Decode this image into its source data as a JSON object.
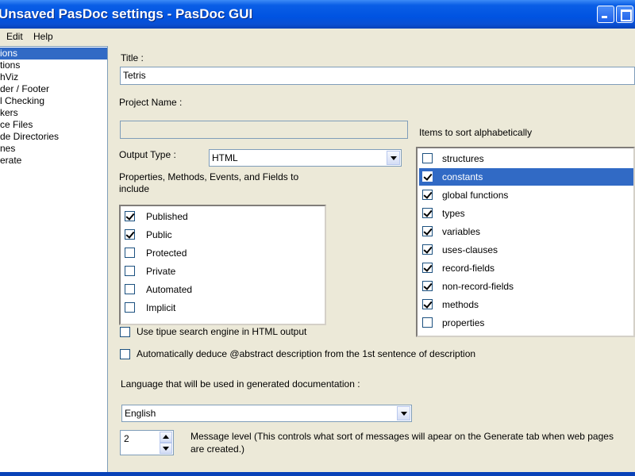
{
  "window": {
    "title": "Unsaved PasDoc settings - PasDoc GUI"
  },
  "menu": {
    "edit": "Edit",
    "help": "Help"
  },
  "sidebar": {
    "items": [
      {
        "label": "ions",
        "selected": true
      },
      {
        "label": "tions",
        "selected": false
      },
      {
        "label": "hViz",
        "selected": false
      },
      {
        "label": "der / Footer",
        "selected": false
      },
      {
        "label": "l Checking",
        "selected": false
      },
      {
        "label": "kers",
        "selected": false
      },
      {
        "label": "ce Files",
        "selected": false
      },
      {
        "label": "de Directories",
        "selected": false
      },
      {
        "label": "nes",
        "selected": false
      },
      {
        "label": "erate",
        "selected": false
      }
    ]
  },
  "form": {
    "title_label": "Title :",
    "title_value": "Tetris",
    "project_name_label": "Project Name :",
    "project_name_value": "",
    "output_type_label": "Output Type :",
    "output_type_value": "HTML",
    "properties_label": "Properties, Methods, Events, and Fields to include",
    "visibility": [
      {
        "label": "Published",
        "checked": true
      },
      {
        "label": "Public",
        "checked": true
      },
      {
        "label": "Protected",
        "checked": false
      },
      {
        "label": "Private",
        "checked": false
      },
      {
        "label": "Automated",
        "checked": false
      },
      {
        "label": "Implicit",
        "checked": false
      }
    ],
    "tipue_label": "Use tipue search engine in HTML output",
    "tipue_checked": false,
    "abstract_label": "Automatically deduce @abstract description from the 1st sentence of description",
    "abstract_checked": false,
    "sort_label": "Items to sort alphabetically",
    "sort_items": [
      {
        "label": "structures",
        "checked": false,
        "selected": false
      },
      {
        "label": "constants",
        "checked": true,
        "selected": true
      },
      {
        "label": "global functions",
        "checked": true,
        "selected": false
      },
      {
        "label": "types",
        "checked": true,
        "selected": false
      },
      {
        "label": "variables",
        "checked": true,
        "selected": false
      },
      {
        "label": "uses-clauses",
        "checked": true,
        "selected": false
      },
      {
        "label": "record-fields",
        "checked": true,
        "selected": false
      },
      {
        "label": "non-record-fields",
        "checked": true,
        "selected": false
      },
      {
        "label": "methods",
        "checked": true,
        "selected": false
      },
      {
        "label": "properties",
        "checked": false,
        "selected": false
      }
    ],
    "language_label": "Language that will be used in generated documentation :",
    "language_value": "English",
    "message_level_value": "2",
    "message_level_label": "Message level (This controls what sort of messages will apear on the Generate tab when web pages are created.)"
  },
  "colors": {
    "selection": "#316ac5",
    "titlebar": "#0053e1",
    "face": "#ece9d8"
  }
}
